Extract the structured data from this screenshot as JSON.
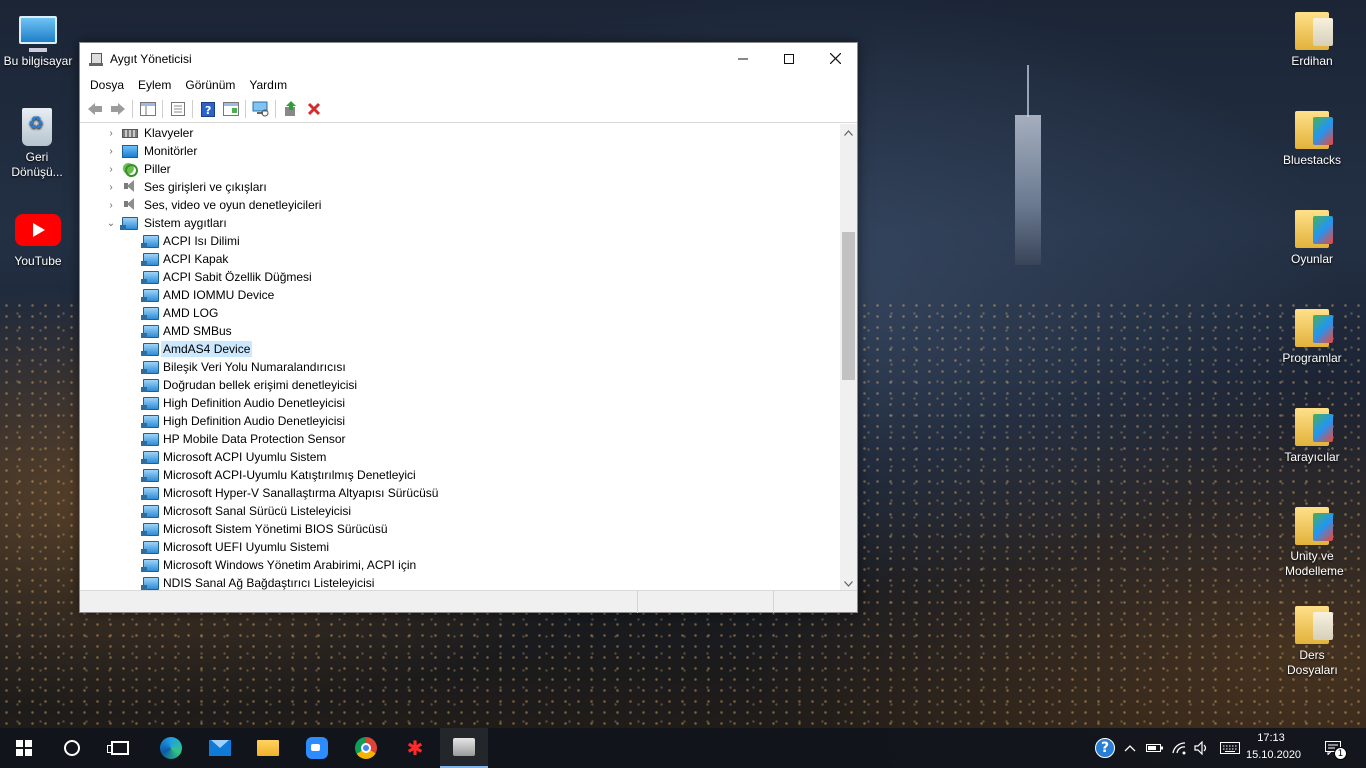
{
  "desktop": {
    "icons_left": [
      {
        "label": "Bu bilgisayar",
        "icon": "computer-icon"
      },
      {
        "label": "Geri Dönüşü...",
        "icon": "recycle-bin-icon"
      },
      {
        "label": "YouTube",
        "icon": "youtube-icon"
      }
    ],
    "icons_right": [
      {
        "label": "Erdihan",
        "icon": "user-folder-icon"
      },
      {
        "label": "Bluestacks",
        "icon": "folder-icon"
      },
      {
        "label": "Oyunlar",
        "icon": "folder-icon"
      },
      {
        "label": "Programlar",
        "icon": "folder-icon"
      },
      {
        "label": "Tarayıcılar",
        "icon": "folder-icon"
      },
      {
        "label": "Unity ve Modelleme",
        "icon": "folder-icon"
      },
      {
        "label": "Ders Dosyaları",
        "icon": "folder-icon"
      }
    ]
  },
  "window": {
    "title": "Aygıt Yöneticisi",
    "menu": [
      "Dosya",
      "Eylem",
      "Görünüm",
      "Yardım"
    ],
    "toolbar_icons": [
      "back-icon",
      "forward-icon",
      "properties-icon",
      "view-icon",
      "help-icon",
      "details-icon",
      "scan-hardware-icon",
      "update-driver-icon",
      "uninstall-icon"
    ],
    "categories_collapsed": [
      {
        "label": "Klavyeler",
        "icon": "keyboard-icon"
      },
      {
        "label": "Monitörler",
        "icon": "monitor-icon"
      },
      {
        "label": "Piller",
        "icon": "battery-icon"
      },
      {
        "label": "Ses girişleri ve çıkışları",
        "icon": "speaker-icon"
      },
      {
        "label": "Ses, video ve oyun denetleyicileri",
        "icon": "speaker-icon"
      }
    ],
    "expanded_category": {
      "label": "Sistem aygıtları",
      "icon": "system-devices-icon"
    },
    "devices": [
      "ACPI Isı Dilimi",
      "ACPI Kapak",
      "ACPI Sabit Özellik Düğmesi",
      "AMD IOMMU Device",
      "AMD LOG",
      "AMD SMBus",
      "AmdAS4 Device",
      "Bileşik Veri Yolu Numaralandırıcısı",
      "Doğrudan bellek erişimi denetleyicisi",
      "High Definition Audio Denetleyicisi",
      "High Definition Audio Denetleyicisi",
      "HP Mobile Data Protection Sensor",
      "Microsoft ACPI Uyumlu Sistem",
      "Microsoft ACPI-Uyumlu Katıştırılmış Denetleyici",
      "Microsoft Hyper-V Sanallaştırma Altyapısı Sürücüsü",
      "Microsoft Sanal Sürücü Listeleyicisi",
      "Microsoft Sistem Yönetimi BIOS Sürücüsü",
      "Microsoft UEFI Uyumlu Sistemi",
      "Microsoft Windows Yönetim Arabirimi, ACPI için",
      "NDIS Sanal Ağ Bağdaştırıcı Listeleyicisi"
    ],
    "selected_device": "AmdAS4 Device"
  },
  "taskbar": {
    "apps": [
      "start-icon",
      "search-icon",
      "task-view-icon",
      "edge-icon",
      "mail-icon",
      "file-explorer-icon",
      "zoom-icon",
      "chrome-icon",
      "red-app-icon",
      "device-manager-icon"
    ],
    "clock_time": "17:13",
    "clock_date": "15.10.2020",
    "notification_count": "1"
  },
  "colors": {
    "selection": "#cce8ff",
    "taskbar_active": "#7eb4ea"
  }
}
